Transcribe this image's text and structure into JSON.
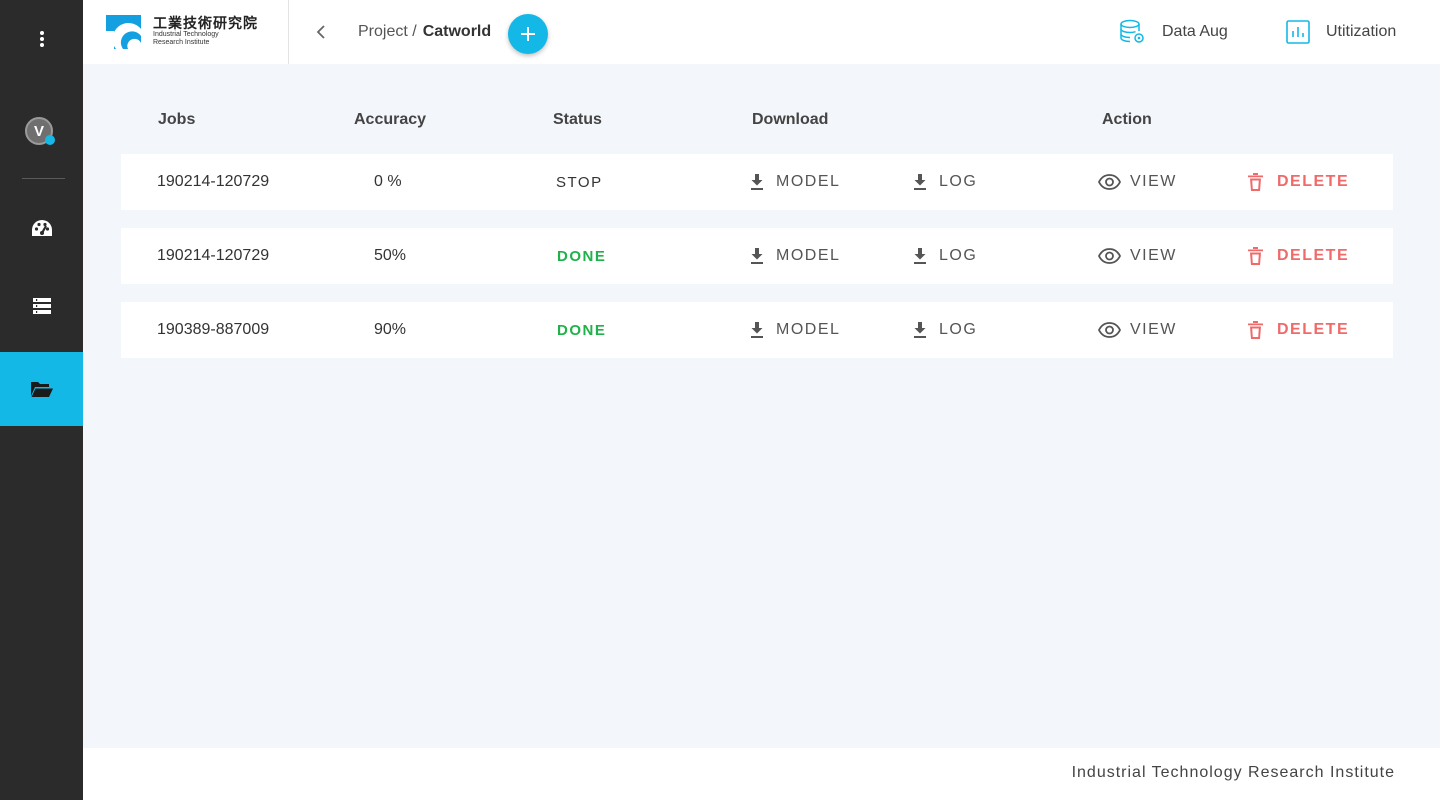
{
  "sidebar": {
    "menu_icon": "more-vertical-icon",
    "avatar_initial": "V",
    "items": [
      {
        "icon": "dashboard-icon"
      },
      {
        "icon": "list-icon"
      },
      {
        "icon": "folder-open-icon",
        "active": true
      }
    ]
  },
  "header": {
    "logo_cn": "工業技術研究院",
    "logo_en_line1": "Industrial Technology",
    "logo_en_line2": "Research Institute",
    "breadcrumb_parent": "Project /",
    "breadcrumb_current": "Catworld",
    "links": [
      {
        "label": "Data Aug",
        "icon": "database-gear-icon"
      },
      {
        "label": "Utitization",
        "icon": "bar-chart-icon"
      }
    ]
  },
  "table": {
    "headers": [
      "Jobs",
      "Accuracy",
      "Status",
      "Download",
      "Action"
    ],
    "rows": [
      {
        "job": "190214-120729",
        "accuracy": "0 %",
        "status": "STOP",
        "model": "MODEL",
        "log": "LOG",
        "view": "VIEW",
        "delete": "DELETE"
      },
      {
        "job": "190214-120729",
        "accuracy": "50%",
        "status": "DONE",
        "model": "MODEL",
        "log": "LOG",
        "view": "VIEW",
        "delete": "DELETE"
      },
      {
        "job": "190389-887009",
        "accuracy": "90%",
        "status": "DONE",
        "model": "MODEL",
        "log": "LOG",
        "view": "VIEW",
        "delete": "DELETE"
      }
    ]
  },
  "footer": {
    "text": "Industrial Technology Research Institute"
  },
  "colors": {
    "accent": "#14b8e6",
    "sidebar_bg": "#2b2b2b",
    "done": "#1fb24a",
    "delete": "#f06a6a"
  }
}
